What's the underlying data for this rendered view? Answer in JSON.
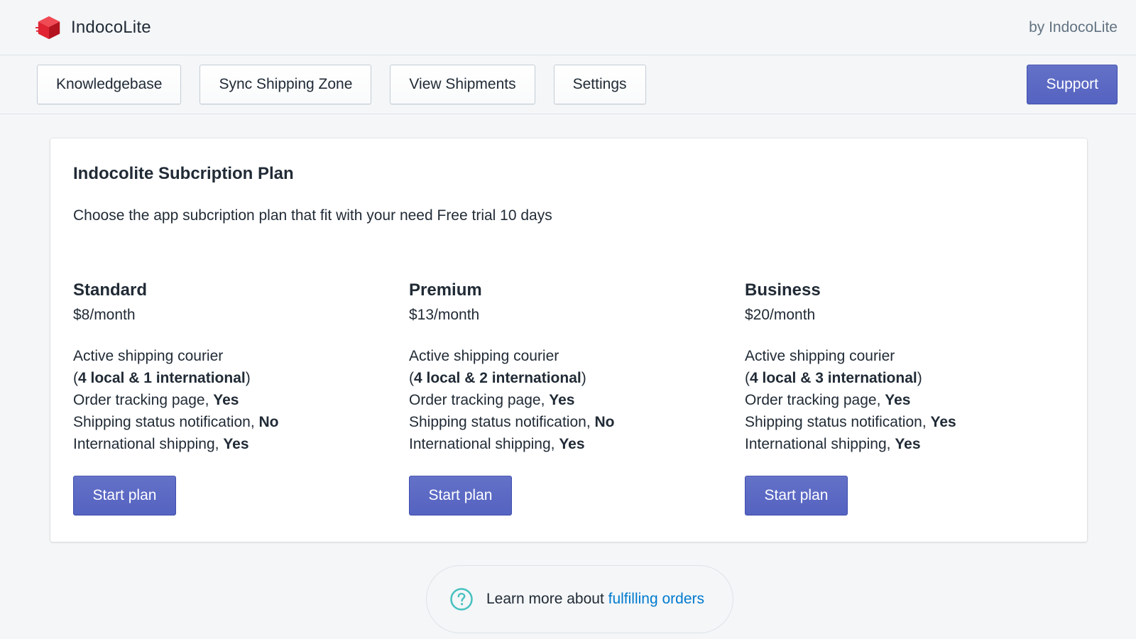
{
  "app": {
    "name": "IndocoLite",
    "by_label": "by IndocoLite",
    "brand_color": "#e02433",
    "icon": "red-cube-icon"
  },
  "toolbar": {
    "buttons": [
      {
        "label": "Knowledgebase"
      },
      {
        "label": "Sync Shipping Zone"
      },
      {
        "label": "View Shipments"
      },
      {
        "label": "Settings"
      }
    ],
    "support_label": "Support",
    "primary_color": "#5c6ac4"
  },
  "subscription": {
    "title": "Indocolite Subcription Plan",
    "description": "Choose the app subcription plan that fit with your need Free trial 10 days",
    "plans": [
      {
        "name": "Standard",
        "price": "$8/month",
        "courier_label": "Active shipping courier",
        "courier_open": "(",
        "courier_value": "4 local & 1 international",
        "courier_close": ")",
        "tracking_label": "Order tracking page, ",
        "tracking_value": "Yes",
        "notification_label": "Shipping status notification, ",
        "notification_value": "No",
        "international_label": "International shipping, ",
        "international_value": "Yes",
        "button_label": "Start plan"
      },
      {
        "name": "Premium",
        "price": "$13/month",
        "courier_label": "Active shipping courier",
        "courier_open": "(",
        "courier_value": "4 local & 2 international",
        "courier_close": ")",
        "tracking_label": "Order tracking page, ",
        "tracking_value": "Yes",
        "notification_label": "Shipping status notification, ",
        "notification_value": "No",
        "international_label": "International shipping, ",
        "international_value": "Yes",
        "button_label": "Start plan"
      },
      {
        "name": "Business",
        "price": "$20/month",
        "courier_label": "Active shipping courier",
        "courier_open": "(",
        "courier_value": "4 local & 3 international",
        "courier_close": ")",
        "tracking_label": "Order tracking page, ",
        "tracking_value": "Yes",
        "notification_label": "Shipping status notification, ",
        "notification_value": "Yes",
        "international_label": "International shipping, ",
        "international_value": "Yes",
        "button_label": "Start plan"
      }
    ]
  },
  "footer": {
    "icon": "question-circle-icon",
    "text": "Learn more about ",
    "link_text": "fulfilling orders",
    "icon_color": "#47c1bf",
    "link_color": "#007ace"
  }
}
